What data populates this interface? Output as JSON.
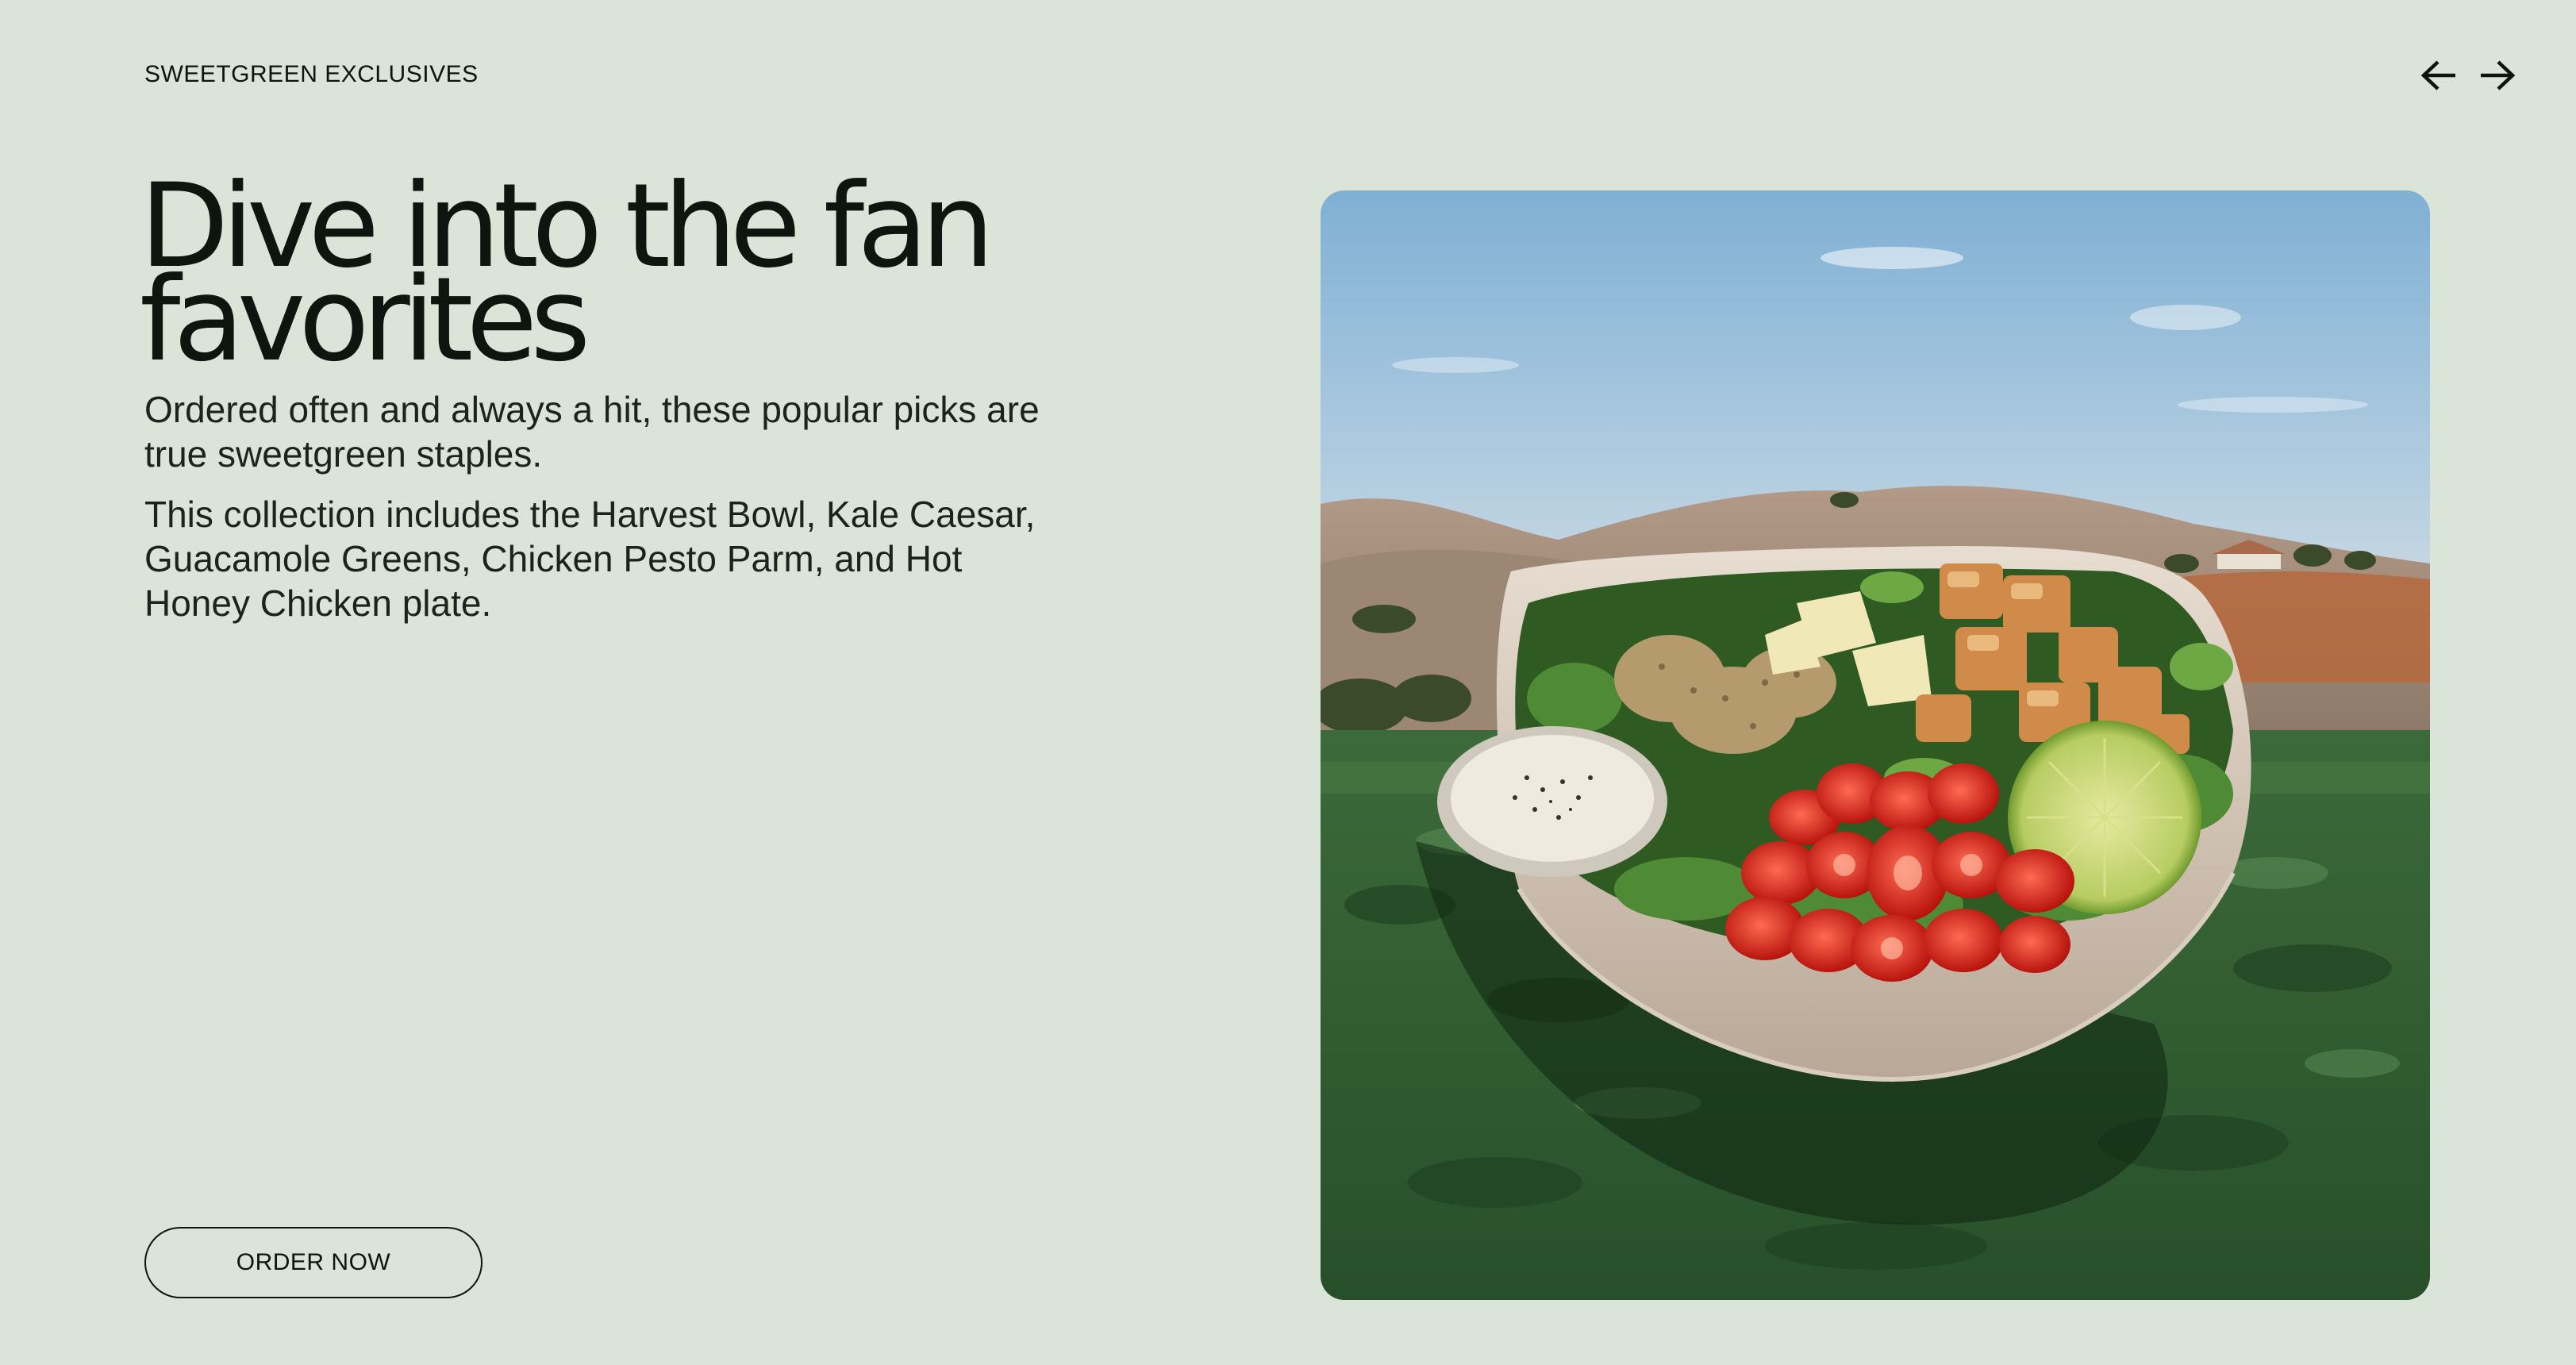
{
  "section": {
    "eyebrow": "SWEETGREEN EXCLUSIVES"
  },
  "nav": {
    "prev_icon": "arrow-left-icon",
    "next_icon": "arrow-right-icon"
  },
  "hero": {
    "title_line_1": "Dive into the fan",
    "title_line_2": "favorites",
    "description_1": "Ordered often and always a hit, these popular picks are true sweetgreen staples.",
    "description_2": "This collection includes the Harvest Bowl, Kale Caesar, Guacamole Greens, Chicken Pesto Parm, and Hot Honey Chicken plate.",
    "cta_label": "ORDER NOW"
  },
  "image": {
    "subject": "salad bowl with chicken, cherry tomatoes, lime and dressing on a field of greens"
  },
  "colors": {
    "background": "#dbe4d8",
    "text": "#0e150e"
  }
}
